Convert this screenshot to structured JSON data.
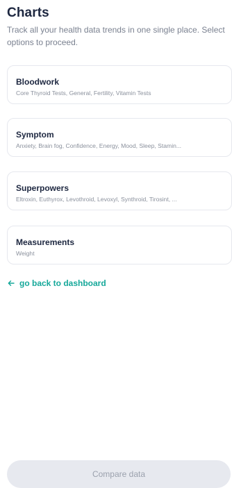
{
  "header": {
    "title": "Charts",
    "subtitle": "Track all your health data trends in one single place. Select options to proceed."
  },
  "cards": [
    {
      "title": "Bloodwork",
      "description": "Core Thyroid Tests, General, Fertility, Vitamin Tests"
    },
    {
      "title": "Symptom",
      "description": "Anxiety, Brain fog, Confidence, Energy, Mood, Sleep, Stamin..."
    },
    {
      "title": "Superpowers",
      "description": "Eltroxin, Euthyrox, Levothroid, Levoxyl, Synthroid, Tirosint, ..."
    },
    {
      "title": "Measurements",
      "description": "Weight"
    }
  ],
  "back_link": {
    "label": "go back to dashboard",
    "icon": "arrow-left-icon"
  },
  "compare_button": {
    "label": "Compare data"
  },
  "colors": {
    "accent": "#16a89a",
    "title": "#1d2740",
    "muted": "#8a909c",
    "card_border": "#e6e8ee",
    "button_bg": "#e7e9ef",
    "button_text": "#9ba1ad"
  }
}
